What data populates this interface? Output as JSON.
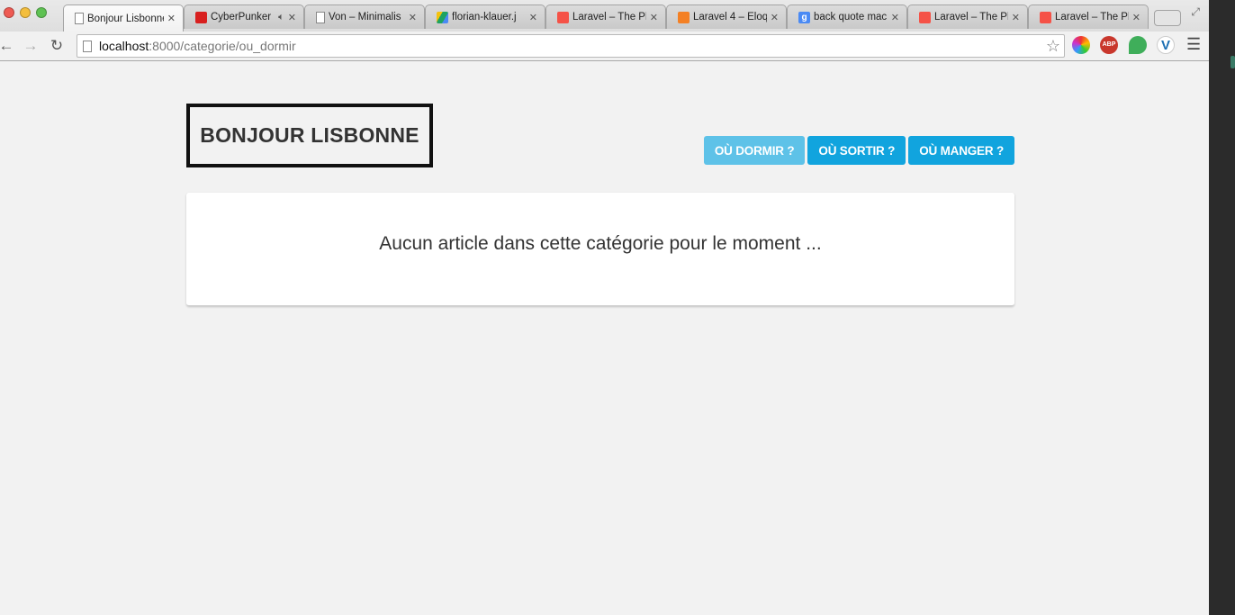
{
  "browser": {
    "tabs": [
      {
        "title": "Bonjour Lisbonne",
        "favicon": "page-icon",
        "active": true
      },
      {
        "title": "CyberPunker",
        "favicon": "youtube-icon",
        "audio": true
      },
      {
        "title": "Von – Minimalis",
        "favicon": "page-icon"
      },
      {
        "title": "florian-klauer.j",
        "favicon": "drive-icon"
      },
      {
        "title": "Laravel – The Ph",
        "favicon": "laravel-icon"
      },
      {
        "title": "Laravel 4 – Eloq",
        "favicon": "stackoverflow-icon"
      },
      {
        "title": "back quote mac",
        "favicon": "google-icon"
      },
      {
        "title": "Laravel – The Ph",
        "favicon": "laravel-icon"
      },
      {
        "title": "Laravel – The Ph",
        "favicon": "laravel-icon"
      }
    ],
    "url_host": "localhost",
    "url_path": ":8000/categorie/ou_dormir"
  },
  "site": {
    "logo": "BONJOUR LISBONNE",
    "nav": [
      {
        "label": "OÙ DORMIR ?",
        "active": true
      },
      {
        "label": "OÙ SORTIR ?",
        "active": false
      },
      {
        "label": "OÙ MANGER ?",
        "active": false
      }
    ],
    "empty_message": "Aucun article dans cette catégorie pour le moment ..."
  },
  "colors": {
    "accent": "#11a4de",
    "accent_active": "#5ec2e8",
    "page_bg": "#f2f2f2"
  }
}
